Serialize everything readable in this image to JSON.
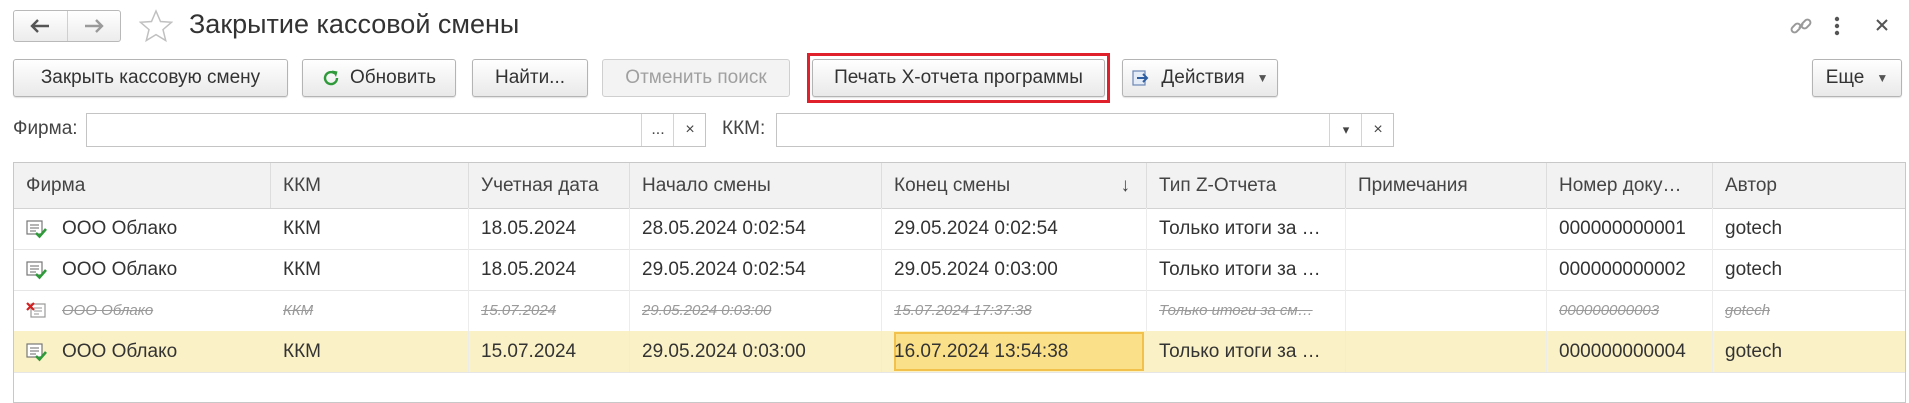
{
  "window": {
    "title": "Закрытие кассовой смены",
    "icons": [
      "back-arrow-icon",
      "forward-arrow-icon",
      "star-icon",
      "link-icon",
      "more-vertical-icon",
      "close-icon"
    ]
  },
  "toolbar": {
    "close_shift": "Закрыть кассовую смену",
    "refresh": "Обновить",
    "find": "Найти...",
    "cancel_search": "Отменить поиск",
    "print_x_report": "Печать X-отчета программы",
    "actions": "Действия",
    "more": "Еще"
  },
  "filters": {
    "firma_label": "Фирма:",
    "firma_value": "",
    "firma_select": "...",
    "clear": "×",
    "kkm_label": "ККМ:",
    "kkm_value": "",
    "dropdown": "▾"
  },
  "table": {
    "columns": [
      "Фирма",
      "ККМ",
      "Учетная дата",
      "Начало смены",
      "Конец смены",
      "Тип Z-Отчета",
      "Примечания",
      "Номер доку…",
      "Автор"
    ],
    "sort_indicator": "↓",
    "rows": [
      {
        "firma": "ООО Облако",
        "kkm": "ККМ",
        "date": "18.05.2024",
        "start": "28.05.2024 0:02:54",
        "end": "29.05.2024 0:02:54",
        "type": "Только итоги за …",
        "notes": "",
        "number": "000000000001",
        "author": "gotech",
        "status": "posted"
      },
      {
        "firma": "ООО Облако",
        "kkm": "ККМ",
        "date": "18.05.2024",
        "start": "29.05.2024 0:02:54",
        "end": "29.05.2024 0:03:00",
        "type": "Только итоги за …",
        "notes": "",
        "number": "000000000002",
        "author": "gotech",
        "status": "posted"
      },
      {
        "firma": "ООО Облако",
        "kkm": "ККМ",
        "date": "15.07.2024",
        "start": "29.05.2024 0:03:00",
        "end": "15.07.2024 17:37:38",
        "type": "Только итоги за см…",
        "notes": "",
        "number": "000000000003",
        "author": "gotech",
        "status": "deleted"
      },
      {
        "firma": "ООО Облако",
        "kkm": "ККМ",
        "date": "15.07.2024",
        "start": "29.05.2024 0:03:00",
        "end": "16.07.2024 13:54:38",
        "type": "Только итоги за …",
        "notes": "",
        "number": "000000000004",
        "author": "gotech",
        "status": "posted",
        "selected": true
      }
    ]
  },
  "colors": {
    "highlight_border": "#e0202a",
    "selected_row": "#fbf1c6",
    "focused_cell": "#fbe08a",
    "refresh_icon": "#2f9a3a"
  }
}
